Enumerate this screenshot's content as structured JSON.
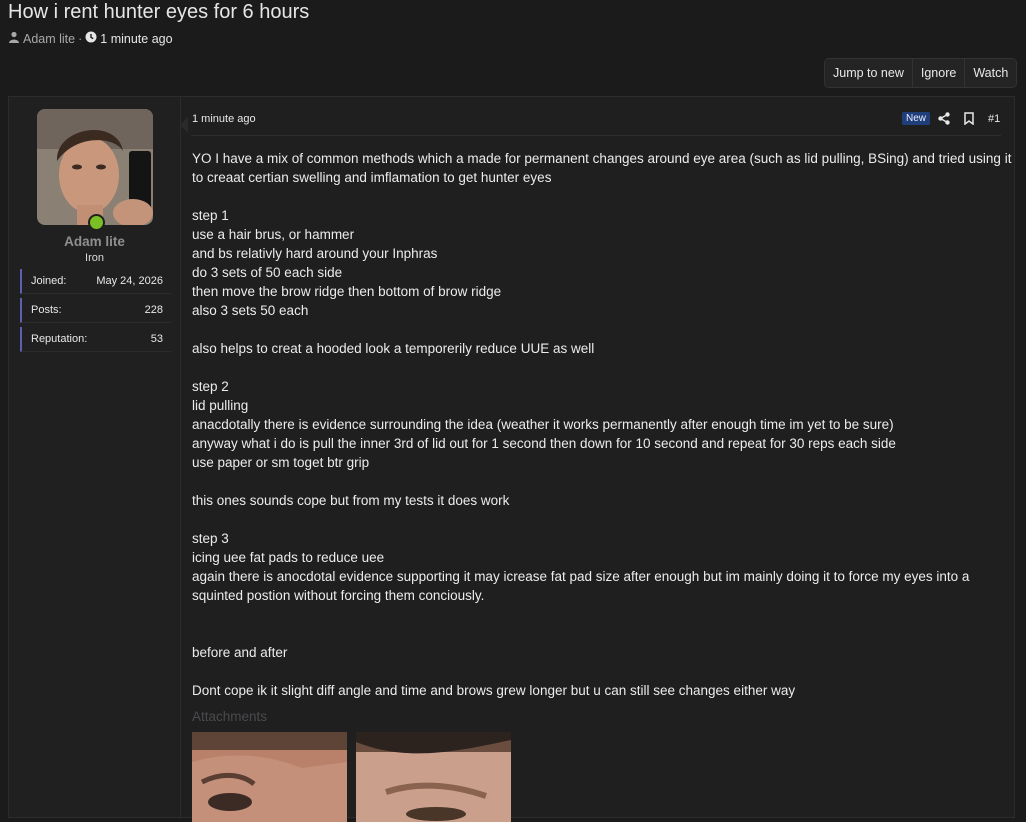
{
  "thread": {
    "title": "How i rent hunter eyes for 6 hours",
    "author": "Adam lite",
    "separator": "·",
    "time": "1 minute ago"
  },
  "actions": [
    {
      "label": "Jump to new"
    },
    {
      "label": "Ignore"
    },
    {
      "label": "Watch"
    }
  ],
  "user": {
    "name": "Adam lite",
    "title": "Iron",
    "stats": [
      {
        "key": "Joined:",
        "value": "May 24, 2026"
      },
      {
        "key": "Posts:",
        "value": "228"
      },
      {
        "key": "Reputation:",
        "value": "53"
      }
    ]
  },
  "post": {
    "time": "1 minute ago",
    "badge": "New",
    "number": "#1",
    "paragraphs": [
      "YO I have a mix of common methods which a made for permanent changes around eye area (such as lid pulling, BSing) and tried using it to creaat certian swelling and imflamation to get hunter eyes",
      "step 1\nuse a hair brus, or hammer\nand bs relativly hard around your Inphras\ndo 3 sets of 50 each side\nthen move the brow ridge then bottom of brow ridge\nalso 3 sets 50 each",
      "also helps to creat a hooded look a temporerily reduce UUE as well",
      "step 2\nlid pulling\nanacdotally there is evidence surrounding the idea (weather it works permanently after enough time im yet to be sure)\nanyway what i do is pull the inner 3rd of lid out for 1 second then down for 10 second and repeat for 30 reps each side\nuse paper or sm toget btr grip",
      "this ones sounds cope but from my tests it does work",
      "step 3\nicing uee fat pads to reduce uee\nagain there is anocdotal evidence supporting it may icrease fat pad size after enough but im mainly doing it to force my eyes into a squinted postion without forcing them conciously.",
      "",
      "before and after",
      "Dont cope ik it slight diff angle and time and brows grew longer but u can still see changes either way"
    ],
    "attachments_label": "Attachments"
  },
  "colors": {
    "background": "#1b1b1c",
    "accent_stat_border": "#5e5fb0",
    "online": "#7ac025",
    "badge": "#1f3e7a"
  },
  "icons": [
    "user-icon",
    "clock-icon",
    "share-icon",
    "bookmark-icon"
  ]
}
